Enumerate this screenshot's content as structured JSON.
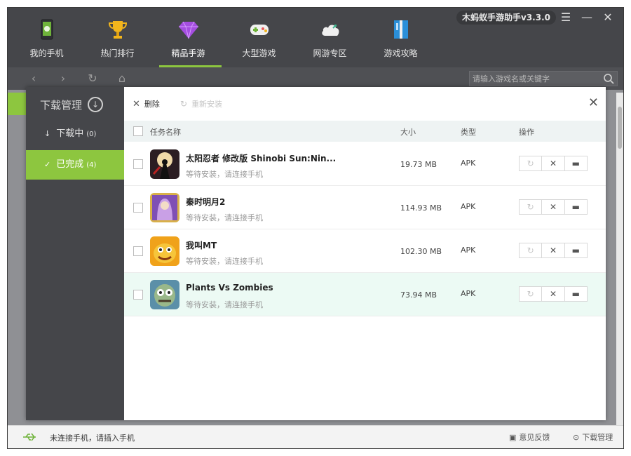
{
  "app": {
    "brand": "木蚂蚁手游助手v3.3.0",
    "accent": "#8dc63f"
  },
  "nav": {
    "items": [
      {
        "label": "我的手机",
        "icon": "phone-icon"
      },
      {
        "label": "热门排行",
        "icon": "trophy-icon"
      },
      {
        "label": "精品手游",
        "icon": "diamond-icon"
      },
      {
        "label": "大型游戏",
        "icon": "gamepad-icon"
      },
      {
        "label": "网游专区",
        "icon": "cloud-icon"
      },
      {
        "label": "游戏攻略",
        "icon": "book-icon"
      }
    ],
    "active": "精品手游"
  },
  "search": {
    "placeholder": "请输入游戏名或关键字"
  },
  "download_manager": {
    "title": "下载管理",
    "tabs": [
      {
        "label": "下载中",
        "count": "(0)"
      },
      {
        "label": "已完成",
        "count": "(4)"
      }
    ],
    "toolbar": {
      "delete_label": "删除",
      "reinstall_label": "重新安装"
    },
    "columns": {
      "name": "任务名称",
      "size": "大小",
      "type": "类型",
      "ops": "操作"
    },
    "rows": [
      {
        "name": "太阳忍者 修改版 Shinobi Sun:Nin...",
        "status": "等待安装，请连接手机",
        "size": "19.73 MB",
        "type": "APK"
      },
      {
        "name": "秦时明月2",
        "status": "等待安装，请连接手机",
        "size": "114.93 MB",
        "type": "APK"
      },
      {
        "name": "我叫MT",
        "status": "等待安装，请连接手机",
        "size": "102.30 MB",
        "type": "APK"
      },
      {
        "name": "Plants Vs Zombies",
        "status": "等待安装，请连接手机",
        "size": "73.94 MB",
        "type": "APK"
      }
    ]
  },
  "statusbar": {
    "connection": "未连接手机，请插入手机",
    "feedback": "意见反馈",
    "download_manager": "下载管理"
  }
}
